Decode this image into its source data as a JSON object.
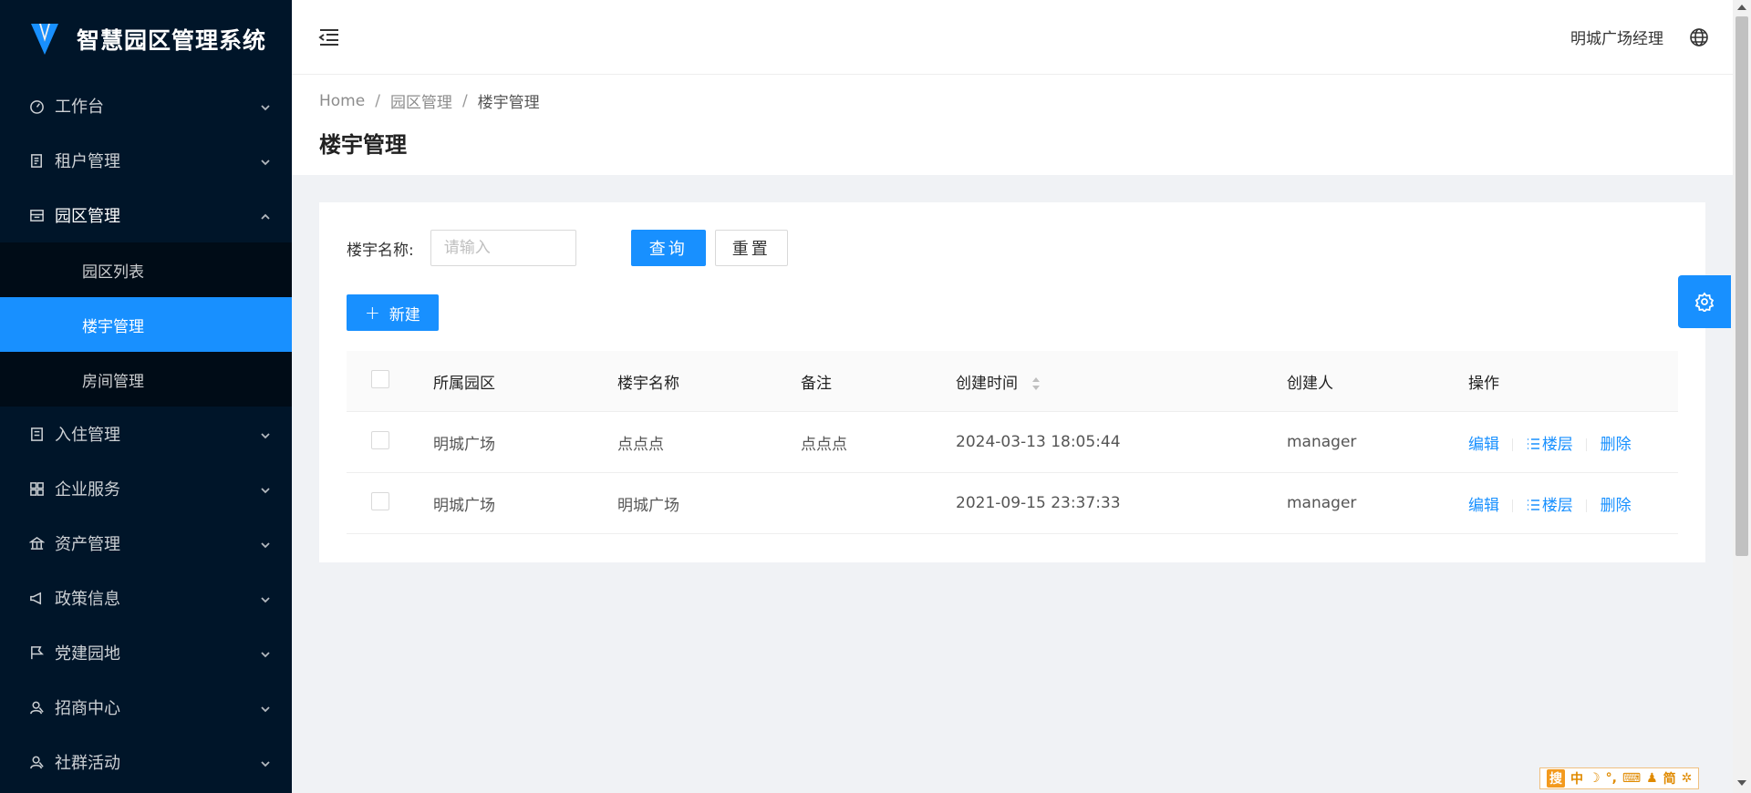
{
  "app": {
    "title": "智慧园区管理系统"
  },
  "sidebar": {
    "items": [
      {
        "label": "工作台",
        "icon": "dashboard-icon"
      },
      {
        "label": "租户管理",
        "icon": "tenant-icon"
      },
      {
        "label": "园区管理",
        "icon": "park-icon",
        "open": true,
        "children": [
          {
            "label": "园区列表"
          },
          {
            "label": "楼宇管理",
            "active": true
          },
          {
            "label": "房间管理"
          }
        ]
      },
      {
        "label": "入住管理",
        "icon": "checkin-icon"
      },
      {
        "label": "企业服务",
        "icon": "grid-icon"
      },
      {
        "label": "资产管理",
        "icon": "bank-icon"
      },
      {
        "label": "政策信息",
        "icon": "megaphone-icon"
      },
      {
        "label": "党建园地",
        "icon": "flag-icon"
      },
      {
        "label": "招商中心",
        "icon": "people-icon"
      },
      {
        "label": "社群活动",
        "icon": "people-icon"
      }
    ]
  },
  "header": {
    "user_name": "明城广场经理"
  },
  "breadcrumb": {
    "home": "Home",
    "level1": "园区管理",
    "level2": "楼宇管理",
    "separator": "/"
  },
  "page": {
    "title": "楼宇管理"
  },
  "search": {
    "label": "楼宇名称:",
    "placeholder": "请输入",
    "value": "",
    "query_label": "查询",
    "reset_label": "重置"
  },
  "toolbar": {
    "new_label": "新建",
    "new_icon": "plus-icon"
  },
  "table": {
    "columns": [
      "所属园区",
      "楼宇名称",
      "备注",
      "创建时间",
      "创建人",
      "操作"
    ],
    "rows": [
      {
        "park": "明城广场",
        "name": "点点点",
        "note": "点点点",
        "created_at": "2024-03-13 18:05:44",
        "creator": "manager"
      },
      {
        "park": "明城广场",
        "name": "明城广场",
        "note": "",
        "created_at": "2021-09-15 23:37:33",
        "creator": "manager"
      }
    ],
    "actions": {
      "edit": "编辑",
      "floors": "楼层",
      "delete": "删除"
    }
  },
  "ime": {
    "items": [
      "搜",
      "中",
      "☽",
      "°,",
      "⌨",
      "♟",
      "简",
      "✲"
    ]
  },
  "colors": {
    "primary": "#1890ff",
    "sidebar_bg": "#001529",
    "submenu_bg": "#000c17"
  }
}
